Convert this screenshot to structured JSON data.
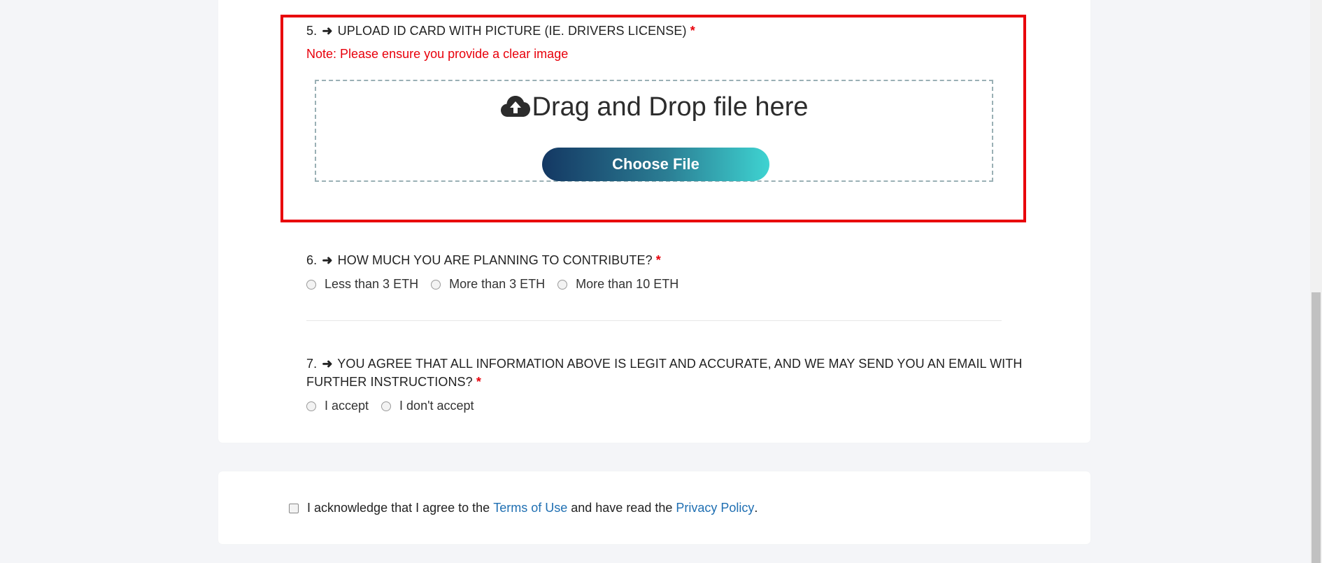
{
  "question5": {
    "number": "5.",
    "label": "UPLOAD ID CARD WITH PICTURE (IE. DRIVERS LICENSE)",
    "required_mark": "*",
    "note": "Note: Please ensure you provide a clear image",
    "dropzone_text": "Drag and Drop file here",
    "choose_button": "Choose File"
  },
  "question6": {
    "number": "6.",
    "label": "HOW MUCH YOU ARE PLANNING TO CONTRIBUTE?",
    "required_mark": "*",
    "options": [
      "Less than 3 ETH",
      "More than 3 ETH",
      "More than 10 ETH"
    ]
  },
  "question7": {
    "number": "7.",
    "label_line1": "YOU AGREE THAT ALL INFORMATION ABOVE IS LEGIT AND ACCURATE, AND WE MAY SEND YOU AN EMAIL WITH",
    "label_line2": "FURTHER INSTRUCTIONS?",
    "required_mark": "*",
    "options": [
      "I accept",
      "I don't accept"
    ]
  },
  "acknowledge": {
    "text_before": "I acknowledge that I agree to the",
    "terms_link": "Terms of Use",
    "text_middle": "and have read the",
    "privacy_link": "Privacy Policy",
    "text_after": "."
  },
  "colors": {
    "required": "#e8000b",
    "link": "#1f6fb2",
    "button_gradient_start": "#143863",
    "button_gradient_end": "#3ed3d1"
  }
}
